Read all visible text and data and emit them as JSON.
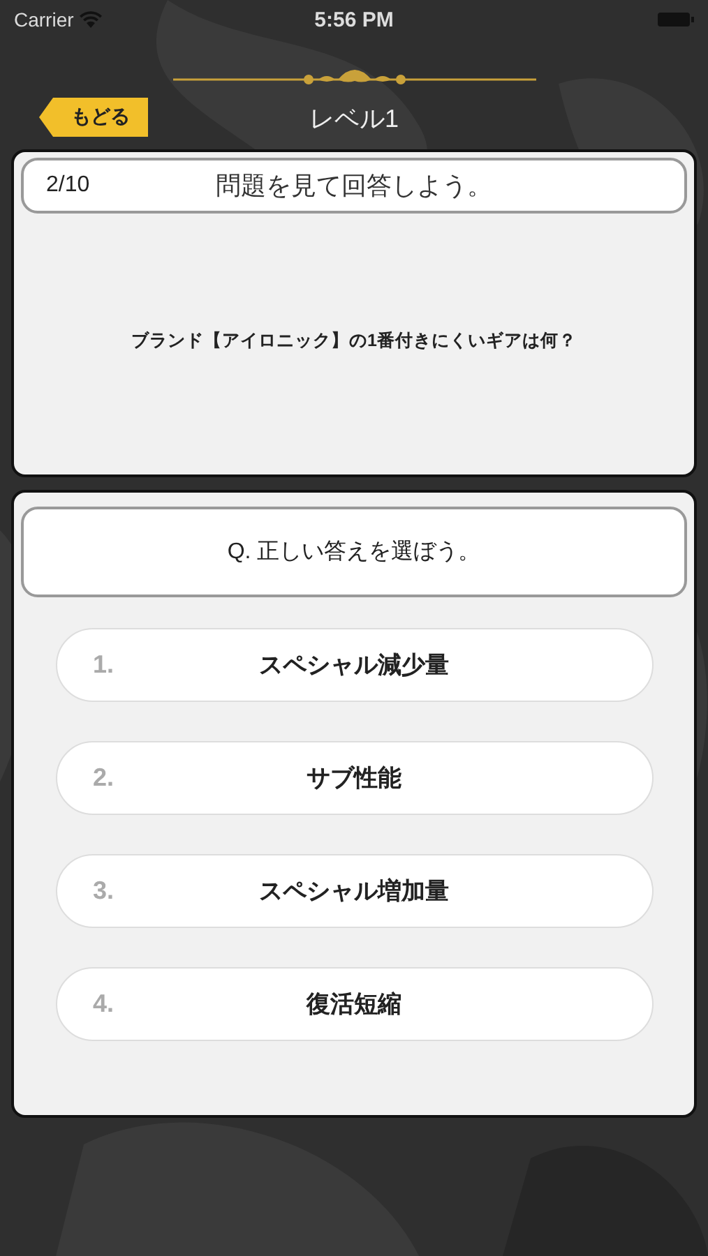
{
  "status_bar": {
    "carrier": "Carrier",
    "time": "5:56 PM"
  },
  "nav": {
    "back": "もどる",
    "title": "レベル1"
  },
  "question_card": {
    "progress": "2/10",
    "instruction": "問題を見て回答しよう。",
    "question": "ブランド【アイロニック】の1番付きにくいギアは何？"
  },
  "answer_card": {
    "prompt": "Q. 正しい答えを選ぼう。",
    "options": [
      {
        "number": "1.",
        "label": "スペシャル減少量"
      },
      {
        "number": "2.",
        "label": "サブ性能"
      },
      {
        "number": "3.",
        "label": "スペシャル増加量"
      },
      {
        "number": "4.",
        "label": "復活短縮"
      }
    ]
  }
}
